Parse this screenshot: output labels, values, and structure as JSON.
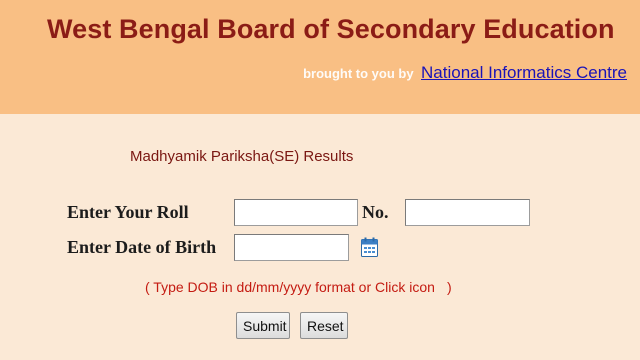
{
  "header": {
    "title": "West Bengal Board of Secondary Education",
    "credit_prefix": "brought to you by",
    "credit_link": "National Informatics Centre"
  },
  "form": {
    "heading": "Madhyamik Pariksha(SE) Results",
    "roll_label": "Enter Your Roll",
    "roll_value": "",
    "no_label": "No.",
    "no_value": "",
    "dob_label": "Enter Date of Birth",
    "dob_value": "",
    "calendar_icon": "calendar-icon",
    "hint_open": "( Type DOB in dd/mm/yyyy format or Click icon",
    "hint_close": ")",
    "submit_label": "Submit",
    "reset_label": "Reset"
  },
  "colors": {
    "header_bg": "#f9bf84",
    "page_bg": "#fbe9d6",
    "title": "#8b1c16",
    "link": "#1a13b8",
    "hint": "#c41b12"
  }
}
